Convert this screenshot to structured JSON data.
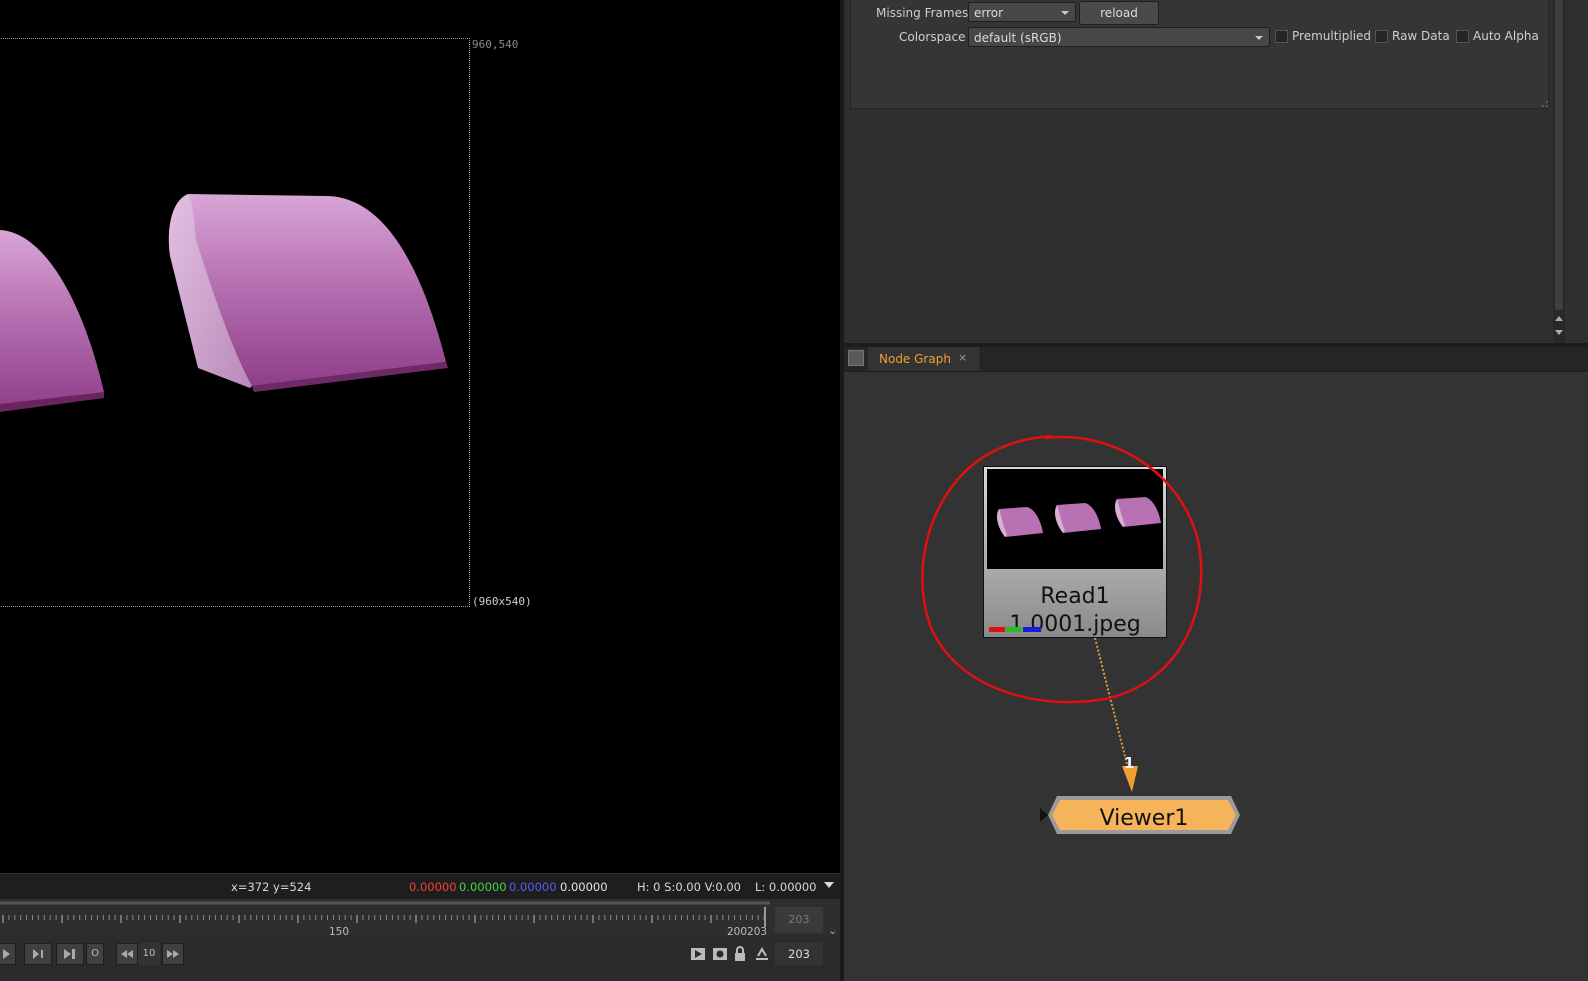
{
  "viewer": {
    "top_right_coords": "960,540",
    "format_label": "(960x540)",
    "cursor_pos": "x=372 y=524",
    "pixel": {
      "r": "0.00000",
      "g": "0.00000",
      "b": "0.00000",
      "a": "0.00000"
    },
    "hsv": "H:  0 S:0.00 V:0.00",
    "luminance": "L: 0.00000"
  },
  "timeline": {
    "tick_mid": "150",
    "tick_end": "200203",
    "end_frame": "203",
    "current_frame": "203"
  },
  "transport": {
    "loop_label": "O",
    "step_value": "10"
  },
  "properties": {
    "missing_frames_label": "Missing Frames",
    "missing_frames_value": "error",
    "reload_label": "reload",
    "colorspace_label": "Colorspace",
    "colorspace_value": "default (sRGB)",
    "premultiplied_label": "Premultiplied",
    "raw_data_label": "Raw Data",
    "auto_alpha_label": "Auto Alpha"
  },
  "node_graph": {
    "tab_label": "Node Graph",
    "tab_close": "×",
    "read_node": {
      "name": "Read1",
      "file": "1.0001.jpeg"
    },
    "viewer_node": {
      "name": "Viewer1"
    },
    "input_number": "1",
    "colors": {
      "read_node_top": "#dadada",
      "viewer_node": "#f7b35a",
      "annotation": "#e01010",
      "pipe": "#d89a40"
    }
  }
}
